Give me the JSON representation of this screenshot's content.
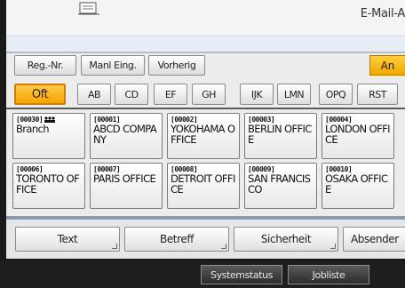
{
  "header": {
    "mode_label": "E-Mail-A"
  },
  "toolbar": {
    "reg_nr": "Reg.-Nr.",
    "manual_input": "Manl Eing.",
    "previous": "Vorherig",
    "an": "An"
  },
  "tabs": [
    {
      "label": "Oft",
      "active": true
    },
    {
      "label": "AB"
    },
    {
      "label": "CD"
    },
    {
      "label": "EF"
    },
    {
      "label": "GH"
    },
    {
      "label": "IJK"
    },
    {
      "label": "LMN"
    },
    {
      "label": "OPQ"
    },
    {
      "label": "RST"
    }
  ],
  "entries": [
    {
      "num": "[00030]",
      "name": "Branch"
    },
    {
      "num": "[00001]",
      "name": "ABCD COMPANY"
    },
    {
      "num": "[00002]",
      "name": "YOKOHAMA OFFICE"
    },
    {
      "num": "[00003]",
      "name": "BERLIN OFFICE"
    },
    {
      "num": "[00004]",
      "name": "LONDON OFFICE"
    },
    {
      "num": "[00006]",
      "name": "TORONTO OFFICE"
    },
    {
      "num": "[00007]",
      "name": "PARIS OFFICE"
    },
    {
      "num": "[00008]",
      "name": "DETROIT OFFICE"
    },
    {
      "num": "[00009]",
      "name": "SAN FRANCISCO"
    },
    {
      "num": "[00010]",
      "name": "OSAKA OFFICE"
    }
  ],
  "bottom_tabs": {
    "text": "Text",
    "subject": "Betreff",
    "security": "Sicherheit",
    "sender": "Absender"
  },
  "system": {
    "status": "Systemstatus",
    "joblist": "Jobliste"
  },
  "colors": {
    "accent": "#f3a600",
    "accent_border": "#d47c00"
  }
}
